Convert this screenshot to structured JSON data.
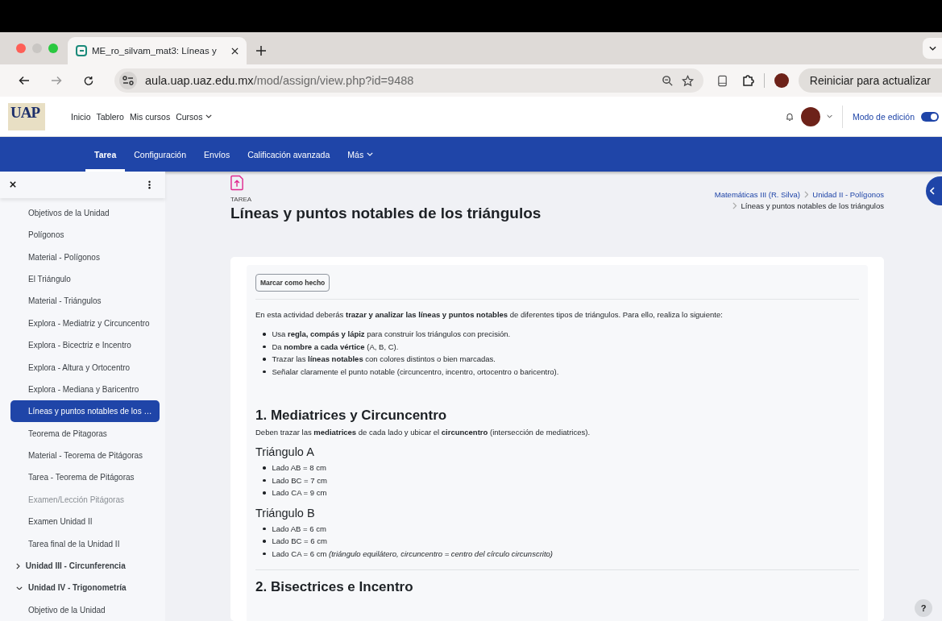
{
  "browser": {
    "tab_title": "ME_ro_silvam_mat3: Líneas y",
    "url_host": "aula.uap.uaz.edu.mx",
    "url_path": "/mod/assign/view.php?id=9488",
    "relaunch_button": "Reiniciar para actualizar"
  },
  "header": {
    "logo": "UAP",
    "nav": [
      {
        "label": "Inicio",
        "dropdown": false
      },
      {
        "label": "Tablero",
        "dropdown": false
      },
      {
        "label": "Mis cursos",
        "dropdown": false
      },
      {
        "label": "Cursos",
        "dropdown": true
      }
    ],
    "edit_mode": {
      "label": "Modo de edición",
      "on": true
    }
  },
  "secondary_nav": [
    {
      "label": "Tarea",
      "selected": true,
      "dropdown": false
    },
    {
      "label": "Configuración",
      "selected": false,
      "dropdown": false
    },
    {
      "label": "Envíos",
      "selected": false,
      "dropdown": false
    },
    {
      "label": "Calificación avanzada",
      "selected": false,
      "dropdown": false
    },
    {
      "label": "Más",
      "selected": false,
      "dropdown": true
    }
  ],
  "drawer": {
    "items": [
      {
        "kind": "activity",
        "label": "Objetivos de la Unidad",
        "selected": false,
        "disabled": false
      },
      {
        "kind": "activity",
        "label": "Polígonos",
        "selected": false,
        "disabled": false
      },
      {
        "kind": "activity",
        "label": "Material - Polígonos",
        "selected": false,
        "disabled": false
      },
      {
        "kind": "activity",
        "label": "El Triángulo",
        "selected": false,
        "disabled": false
      },
      {
        "kind": "activity",
        "label": "Material - Triángulos",
        "selected": false,
        "disabled": false
      },
      {
        "kind": "activity",
        "label": "Explora - Mediatriz y Circuncentro",
        "selected": false,
        "disabled": false
      },
      {
        "kind": "activity",
        "label": "Explora - Bicectriz e Incentro",
        "selected": false,
        "disabled": false
      },
      {
        "kind": "activity",
        "label": "Explora - Altura y Ortocentro",
        "selected": false,
        "disabled": false
      },
      {
        "kind": "activity",
        "label": "Explora - Mediana y Baricentro",
        "selected": false,
        "disabled": false
      },
      {
        "kind": "activity",
        "label": "Líneas y puntos notables de los …",
        "selected": true,
        "disabled": false
      },
      {
        "kind": "activity",
        "label": "Teorema de Pitagoras",
        "selected": false,
        "disabled": false
      },
      {
        "kind": "activity",
        "label": "Material - Teorema de Pitágoras",
        "selected": false,
        "disabled": false
      },
      {
        "kind": "activity",
        "label": "Tarea - Teorema de Pitágoras",
        "selected": false,
        "disabled": false
      },
      {
        "kind": "activity",
        "label": "Examen/Lección Pitágoras",
        "selected": false,
        "disabled": true
      },
      {
        "kind": "activity",
        "label": "Examen Unidad II",
        "selected": false,
        "disabled": false
      },
      {
        "kind": "activity",
        "label": "Tarea final de la Unidad II",
        "selected": false,
        "disabled": false
      },
      {
        "kind": "section",
        "label": "Unidad III - Circunferencia",
        "expanded": false
      },
      {
        "kind": "section",
        "label": "Unidad IV - Trigonometría",
        "expanded": true
      },
      {
        "kind": "activity",
        "label": "Objetivo de la Unidad",
        "selected": false,
        "disabled": false
      }
    ]
  },
  "page": {
    "activity_type": "TAREA",
    "title": "Líneas y puntos notables de los triángulos",
    "breadcrumb": [
      "Matemáticas III (R. Silva)",
      "Unidad II - Polígonos"
    ],
    "breadcrumb_current": "Líneas y puntos notables de los triángulos",
    "completion_button": "Marcar como hecho",
    "blocks": [
      {
        "kind": "p",
        "text": "En esta actividad deberás **trazar y analizar las líneas y puntos notables** de diferentes tipos de triángulos. Para ello, realiza lo siguiente:"
      },
      {
        "kind": "list",
        "items": [
          "Usa **regla, compás y lápiz** para construir los triángulos con precisión.",
          "Da **nombre a cada vértice** (A, B, C).",
          "Trazar las **líneas notables** con colores distintos o bien marcadas.",
          "Señalar claramente el punto notable (circuncentro, incentro, ortocentro o baricentro)."
        ]
      },
      {
        "kind": "h2",
        "text": "1. Mediatrices y Circuncentro"
      },
      {
        "kind": "p",
        "text": "Deben trazar las **mediatrices** de cada lado y ubicar el **circuncentro** (intersección de mediatrices)."
      },
      {
        "kind": "h3",
        "text": "Triángulo A"
      },
      {
        "kind": "list",
        "items": [
          "Lado AB = 8 cm",
          "Lado BC = 7 cm",
          "Lado CA = 9 cm"
        ]
      },
      {
        "kind": "h3",
        "text": "Triángulo B"
      },
      {
        "kind": "list",
        "items": [
          "Lado AB = 6 cm",
          "Lado BC = 6 cm",
          "Lado CA = 6 cm *(triángulo equilátero, circuncentro = centro del círculo circunscrito)*"
        ]
      },
      {
        "kind": "rule"
      },
      {
        "kind": "h2",
        "text": "2. Bisectrices e Incentro"
      }
    ]
  },
  "help_button": "?"
}
